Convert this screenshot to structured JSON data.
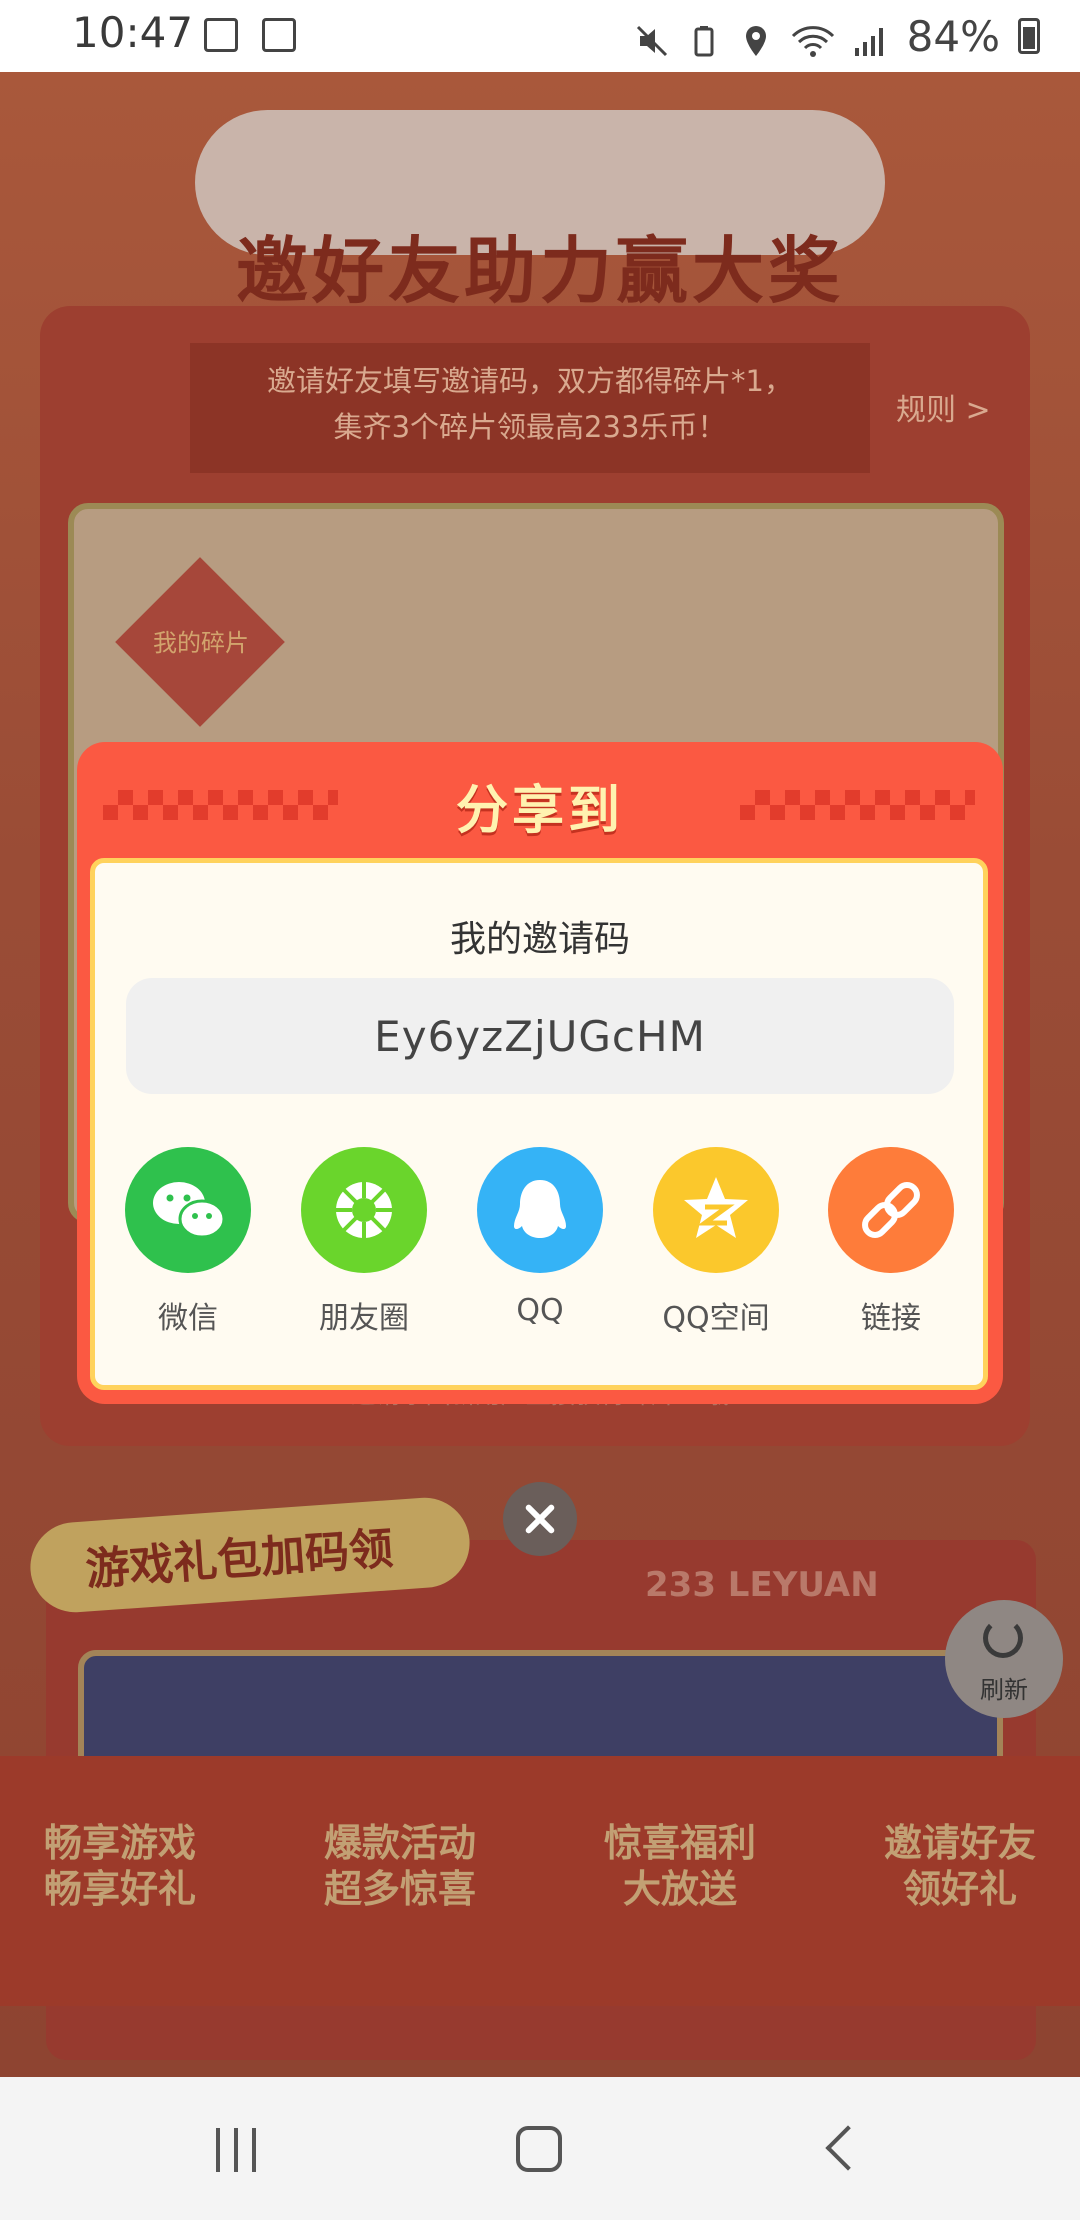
{
  "status_bar": {
    "time": "10:47",
    "battery": "84%",
    "icons": [
      "image-icon",
      "close-box-icon",
      "mute-icon",
      "battery-saver-icon",
      "location-icon",
      "wifi-icon",
      "signal-icon",
      "battery-icon"
    ]
  },
  "background": {
    "title": "邀好友助力赢大奖",
    "banner_line1": "邀请好友填写邀请码，双方都得碎片*1，",
    "banner_line2": "集齐3个碎片领最高233乐币！",
    "rules": "规则 >",
    "my_fragments": "我的碎片",
    "tip": "邀请乐园新用户直接获得碎片*3哦",
    "gift_title": "游戏礼包加码领",
    "brand": "233 LEYUAN",
    "refresh": "刷新",
    "promos": [
      {
        "line1": "畅享游戏",
        "line2": "畅享好礼"
      },
      {
        "line1": "爆款活动",
        "line2": "超多惊喜"
      },
      {
        "line1": "惊喜福利",
        "line2": "大放送"
      },
      {
        "line1": "邀请好友",
        "line2": "领好礼"
      }
    ]
  },
  "modal": {
    "title": "分享到",
    "code_label": "我的邀请码",
    "invite_code": "Ey6yzZjUGcHM",
    "share_options": [
      {
        "label": "微信",
        "icon": "wechat-icon",
        "color": "#2fc14d"
      },
      {
        "label": "朋友圈",
        "icon": "moments-icon",
        "color": "#6ad52c"
      },
      {
        "label": "QQ",
        "icon": "qq-icon",
        "color": "#35b3f6"
      },
      {
        "label": "QQ空间",
        "icon": "qzone-icon",
        "color": "#fbc82c"
      },
      {
        "label": "链接",
        "icon": "link-icon",
        "color": "#fe7c3a"
      }
    ]
  },
  "colors": {
    "modal_bg": "#fb5942",
    "inner_bg": "#fffbf1",
    "title_color": "#fff2b0"
  }
}
